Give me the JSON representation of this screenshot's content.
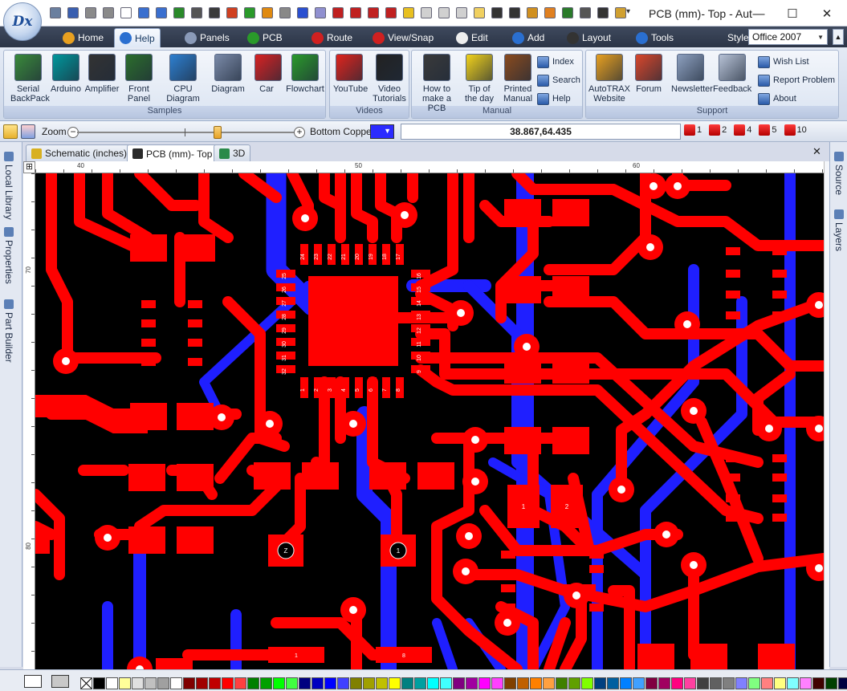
{
  "app": {
    "logo_text": "Dx",
    "title": "PCB (mm)- Top - Aut"
  },
  "menu": {
    "tabs": [
      {
        "label": "Home",
        "icon": "home-icon"
      },
      {
        "label": "Help",
        "icon": "help-icon",
        "active": true
      },
      {
        "label": "Panels",
        "icon": "panels-icon"
      },
      {
        "label": "PCB",
        "icon": "pcb-icon"
      },
      {
        "label": "Route",
        "icon": "route-icon"
      },
      {
        "label": "View/Snap",
        "icon": "view-snap-icon"
      },
      {
        "label": "Edit",
        "icon": "edit-icon"
      },
      {
        "label": "Add",
        "icon": "add-icon"
      },
      {
        "label": "Layout",
        "icon": "layout-icon"
      },
      {
        "label": "Tools",
        "icon": "tools-icon"
      }
    ],
    "style_label": "Style",
    "style_value": "Office 2007"
  },
  "ribbon": {
    "groups": [
      {
        "label": "Samples",
        "buttons": [
          {
            "label": "Serial BackPack",
            "icon": "serial-backpack-icon",
            "color": "#3a8a3a"
          },
          {
            "label": "Arduino",
            "icon": "arduino-icon",
            "color": "#00979c"
          },
          {
            "label": "Amplifier",
            "icon": "amplifier-icon",
            "color": "#333333"
          },
          {
            "label": "Front Panel",
            "icon": "front-panel-icon",
            "color": "#2c6e2c"
          },
          {
            "label": "CPU Diagram",
            "icon": "cpu-diagram-icon",
            "color": "#2d7fd0"
          },
          {
            "label": "Diagram",
            "icon": "diagram-icon",
            "color": "#7a8aa8"
          },
          {
            "label": "Car",
            "icon": "car-icon",
            "color": "#d92222"
          },
          {
            "label": "Flowchart",
            "icon": "flowchart-icon",
            "color": "#2b9a2b"
          }
        ]
      },
      {
        "label": "Videos",
        "buttons": [
          {
            "label": "YouTube",
            "icon": "youtube-icon",
            "color": "#e0241c"
          },
          {
            "label": "Video Tutorials",
            "icon": "video-tutorials-icon",
            "color": "#222222"
          }
        ]
      },
      {
        "label": "Manual",
        "buttons": [
          {
            "label": "How to make a PCB",
            "icon": "graduate-icon",
            "color": "#3a3a3a"
          },
          {
            "label": "Tip of the day",
            "icon": "lightbulb-icon",
            "color": "#f2d21b"
          },
          {
            "label": "Printed Manual",
            "icon": "books-icon",
            "color": "#8a4b1e"
          }
        ],
        "small": [
          {
            "label": "Index",
            "icon": "index-icon"
          },
          {
            "label": "Search",
            "icon": "search-icon"
          },
          {
            "label": "Help",
            "icon": "help-circle-icon"
          }
        ]
      },
      {
        "label": "Support",
        "buttons": [
          {
            "label": "AutoTRAX Website",
            "icon": "house-icon",
            "color": "#e8a020"
          },
          {
            "label": "Forum",
            "icon": "forum-icon",
            "color": "#d9472b"
          },
          {
            "label": "Newsletter",
            "icon": "newsletter-icon",
            "color": "#8da0bf"
          },
          {
            "label": "Feedback",
            "icon": "envelope-icon",
            "color": "#b7c2d6"
          }
        ],
        "small": [
          {
            "label": "Wish List",
            "icon": "wish-list-icon"
          },
          {
            "label": "Report Problem",
            "icon": "report-problem-icon"
          },
          {
            "label": "About",
            "icon": "about-icon"
          }
        ]
      }
    ]
  },
  "zoombar": {
    "zoom_label": "Zoom",
    "layer_label": "Bottom Copper",
    "layer_color": "#2b2bff",
    "coords": "38.867,64.435",
    "grid_steps": [
      "1",
      "2",
      "4",
      "5",
      "10"
    ]
  },
  "sidepanels": {
    "left": [
      "Local Library",
      "Properties",
      "Part Builder"
    ],
    "right": [
      "Source",
      "Layers"
    ]
  },
  "doctabs": [
    {
      "label": "Schematic (inches)",
      "icon": "schematic-icon"
    },
    {
      "label": "PCB (mm)- Top",
      "icon": "pcb-tab-icon",
      "active": true
    },
    {
      "label": "3D",
      "icon": "3d-icon"
    }
  ],
  "ruler": {
    "h_ticks": [
      "40",
      "50",
      "60"
    ],
    "v_ticks": [
      "70",
      "80"
    ]
  },
  "pcb": {
    "top_color": "#ff0000",
    "bottom_color": "#1f1fff",
    "background": "#000000",
    "chip_top_pins": [
      "24",
      "23",
      "22",
      "21",
      "20",
      "19",
      "18",
      "17"
    ],
    "chip_left_pins": [
      "25",
      "26",
      "27",
      "28",
      "29",
      "30",
      "31",
      "32"
    ],
    "chip_right_pins": [
      "16",
      "15",
      "14",
      "13",
      "12",
      "11",
      "10",
      "9"
    ],
    "chip_bottom_pins": [
      "1",
      "2",
      "3",
      "4",
      "5",
      "6",
      "7",
      "8"
    ],
    "pad_labels": {
      "sot": [
        "Z",
        "1"
      ],
      "big": [
        "1",
        "2"
      ],
      "trace_pads": [
        "1",
        "8"
      ]
    }
  },
  "palette": [
    "#000000",
    "#ffffff",
    "#ffff99",
    "#e0e0e0",
    "#c0c0c0",
    "#a0a0a0",
    "#ffffff",
    "#800000",
    "#a00000",
    "#c00000",
    "#ff0000",
    "#ff4040",
    "#008000",
    "#00a000",
    "#00ff00",
    "#40ff40",
    "#000080",
    "#0000c0",
    "#0000ff",
    "#4040ff",
    "#808000",
    "#a0a000",
    "#c0c000",
    "#ffff00",
    "#008080",
    "#00a0a0",
    "#00ffff",
    "#40ffff",
    "#800080",
    "#a000a0",
    "#ff00ff",
    "#ff40ff",
    "#804000",
    "#c06000",
    "#ff8000",
    "#ffa040",
    "#408000",
    "#60a000",
    "#80ff00",
    "#004080",
    "#0060a0",
    "#0080ff",
    "#40a0ff",
    "#800040",
    "#a00060",
    "#ff0080",
    "#ff40a0",
    "#404040",
    "#606060",
    "#808080",
    "#8080ff",
    "#80ff80",
    "#ff8080",
    "#ffff80",
    "#80ffff",
    "#ff80ff",
    "#400000",
    "#004000",
    "#000040",
    "#404000",
    "#004040",
    "#400040",
    "#c0c0ff",
    "#c0ffc0",
    "#ffc0c0",
    "#a0522d"
  ]
}
